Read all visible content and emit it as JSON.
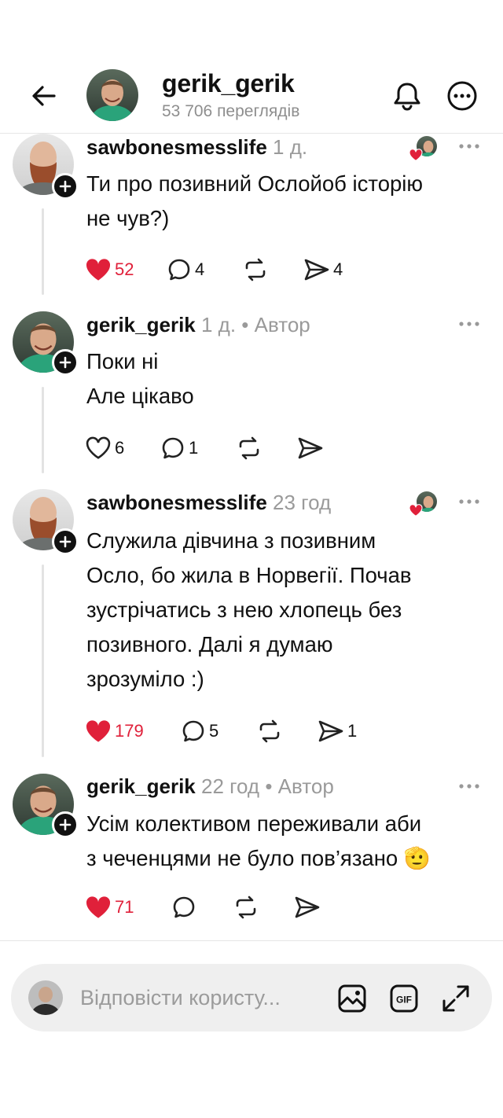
{
  "header": {
    "title": "gerik_gerik",
    "views": "53 706 переглядів"
  },
  "comments": [
    {
      "user": "sawbonesmesslife",
      "time": "1 д.",
      "author": "",
      "text": [
        "Ти про позивний Ослойоб історію",
        "не чув?)"
      ],
      "likes": "52",
      "liked": true,
      "replies": "4",
      "reposts": "",
      "shares": "4",
      "liked_by_author": true
    },
    {
      "user": "gerik_gerik",
      "time": "1 д.",
      "author": "• Автор",
      "text": [
        "Поки ні",
        "Але цікаво"
      ],
      "likes": "6",
      "liked": false,
      "replies": "1",
      "reposts": "",
      "shares": "",
      "liked_by_author": false
    },
    {
      "user": "sawbonesmesslife",
      "time": "23 год",
      "author": "",
      "text": [
        "Служила дівчина з позивним",
        "Осло, бо жила в Норвегії. Почав",
        "зустрічатись з нею хлопець без",
        "позивного. Далі я думаю",
        "зрозуміло :)"
      ],
      "likes": "179",
      "liked": true,
      "replies": "5",
      "reposts": "",
      "shares": "1",
      "liked_by_author": true
    },
    {
      "user": "gerik_gerik",
      "time": "22 год",
      "author": "• Автор",
      "text": [
        "Усім колективом переживали аби",
        "з чеченцями не було пов’язано 🫡"
      ],
      "likes": "71",
      "liked": true,
      "replies": "",
      "reposts": "",
      "shares": "",
      "liked_by_author": false
    }
  ],
  "reply": {
    "placeholder": "Відповісти користу..."
  },
  "icons": {
    "back": "arrow-left-icon",
    "bell": "bell-icon",
    "more": "more-circle-icon",
    "like": "heart-icon",
    "reply": "comment-bubble-icon",
    "repost": "repost-icon",
    "share": "send-icon",
    "image": "image-icon",
    "gif": "gif-icon",
    "expand": "expand-icon"
  },
  "colors": {
    "like_red": "#e0203a",
    "muted": "#9a9a9a",
    "text": "#111111",
    "reply_bar_bg": "#efefef"
  }
}
